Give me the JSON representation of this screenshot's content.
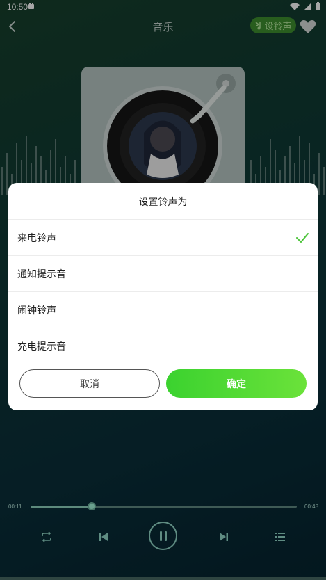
{
  "status": {
    "time": "10:50"
  },
  "header": {
    "title": "音乐",
    "ringtone_button": "设铃声"
  },
  "dialog": {
    "title": "设置铃声为",
    "options": [
      {
        "label": "来电铃声",
        "selected": true
      },
      {
        "label": "通知提示音",
        "selected": false
      },
      {
        "label": "闹钟铃声",
        "selected": false
      },
      {
        "label": "充电提示音",
        "selected": false
      }
    ],
    "cancel_label": "取消",
    "confirm_label": "确定"
  },
  "player": {
    "elapsed": "00:11",
    "duration": "00:48",
    "progress": 0.23
  },
  "colors": {
    "accent": "#3bd22f",
    "check": "#4cc43a",
    "pill": "#3e8f2e"
  }
}
